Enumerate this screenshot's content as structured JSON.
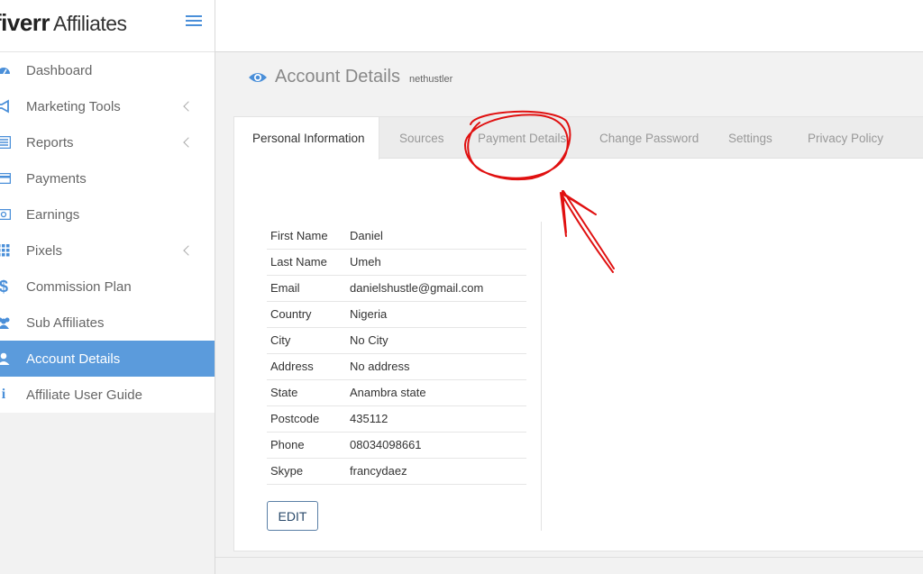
{
  "brand": {
    "logo_main": "fiverr",
    "logo_sub": "Affiliates"
  },
  "nav": {
    "items": [
      {
        "label": "Dashboard",
        "icon": "dashboard-icon"
      },
      {
        "label": "Marketing Tools",
        "icon": "megaphone-icon"
      },
      {
        "label": "Reports",
        "icon": "list-icon"
      },
      {
        "label": "Payments",
        "icon": "credit-card-icon"
      },
      {
        "label": "Earnings",
        "icon": "money-icon"
      },
      {
        "label": "Pixels",
        "icon": "grid-icon"
      },
      {
        "label": "Commission Plan",
        "icon": "dollar-icon"
      },
      {
        "label": "Sub Affiliates",
        "icon": "users-icon"
      },
      {
        "label": "Account Details",
        "icon": "user-icon"
      },
      {
        "label": "Affiliate User Guide",
        "icon": "info-icon"
      }
    ]
  },
  "page": {
    "title": "Account Details",
    "username": "nethustler"
  },
  "tabs": [
    {
      "label": "Personal Information"
    },
    {
      "label": "Sources"
    },
    {
      "label": "Payment Details"
    },
    {
      "label": "Change Password"
    },
    {
      "label": "Settings"
    },
    {
      "label": "Privacy Policy"
    }
  ],
  "info": [
    {
      "key": "First Name",
      "value": "Daniel"
    },
    {
      "key": "Last Name",
      "value": "Umeh"
    },
    {
      "key": "Email",
      "value": "danielshustle@gmail.com"
    },
    {
      "key": "Country",
      "value": "Nigeria"
    },
    {
      "key": "City",
      "value": "No City"
    },
    {
      "key": "Address",
      "value": "No address"
    },
    {
      "key": "State",
      "value": "Anambra state"
    },
    {
      "key": "Postcode",
      "value": "435112"
    },
    {
      "key": "Phone",
      "value": "08034098661"
    },
    {
      "key": "Skype",
      "value": "francydaez"
    }
  ],
  "edit_label": "EDIT",
  "colors": {
    "accent": "#5b9bdc",
    "icon": "#4a8fd9",
    "annotation": "#e01010"
  }
}
